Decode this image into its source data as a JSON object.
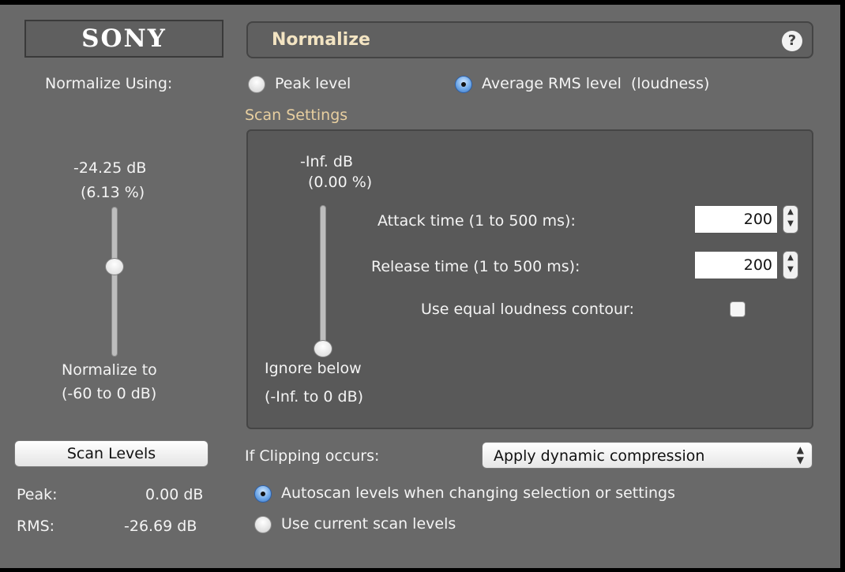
{
  "header": {
    "logo": "SONY",
    "title": "Normalize",
    "help": "?"
  },
  "normalize_using": {
    "label": "Normalize Using:",
    "options": [
      {
        "label": "Peak level",
        "selected": false
      },
      {
        "label": "Average RMS level  (loudness)",
        "selected": true
      }
    ]
  },
  "normalize_slider": {
    "db": "-24.25 dB",
    "percent": "(6.13 %)",
    "label_line1": "Normalize to",
    "label_line2": "(-60 to 0 dB)",
    "level_fraction": 0.6
  },
  "scan_settings": {
    "label": "Scan Settings",
    "ignore_slider": {
      "db": "-Inf. dB",
      "percent": "(0.00 %)",
      "label_line1": "Ignore below",
      "label_line2": "(-Inf. to 0 dB)",
      "level_fraction": 0.0
    },
    "attack": {
      "label": "Attack time (1 to 500 ms):",
      "value": "200"
    },
    "release": {
      "label": "Release time (1 to 500 ms):",
      "value": "200"
    },
    "equal_loudness": {
      "label": "Use equal loudness contour:",
      "checked": false
    }
  },
  "scan_button": {
    "label": "Scan Levels"
  },
  "levels": {
    "peak_label": "Peak:",
    "peak_value": "0.00 dB",
    "rms_label": "RMS:",
    "rms_value": "-26.69 dB"
  },
  "clipping": {
    "label": "If Clipping occurs:",
    "selected": "Apply dynamic compression"
  },
  "scan_mode": {
    "options": [
      {
        "label": "Autoscan levels when changing selection or settings",
        "selected": true
      },
      {
        "label": "Use current scan levels",
        "selected": false
      }
    ]
  }
}
